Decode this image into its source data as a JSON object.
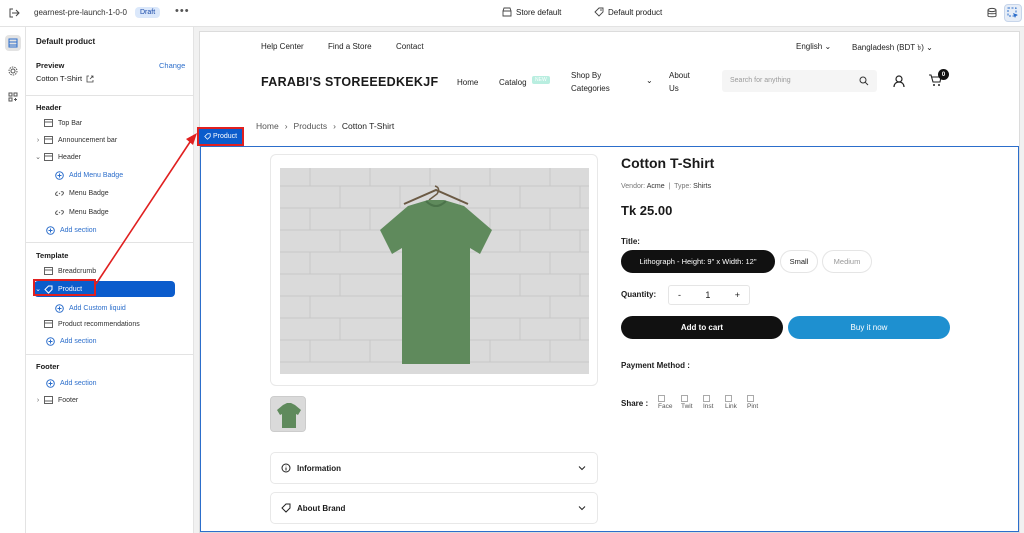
{
  "topbar": {
    "theme_name": "gearnest-pre-launch-1-0-0",
    "status_badge": "Draft",
    "more": "•••",
    "store_selector": "Store default",
    "template_selector": "Default product"
  },
  "sidebar": {
    "title": "Default product",
    "preview_label": "Preview",
    "change_link": "Change",
    "preview_value": "Cotton T-Shirt",
    "groups": {
      "header": {
        "label": "Header",
        "top_bar": "Top Bar",
        "announcement_bar": "Announcement bar",
        "header": "Header",
        "add_menu_badge": "Add Menu Badge",
        "menu_badge_1": "Menu Badge",
        "menu_badge_2": "Menu Badge",
        "add_section": "Add section"
      },
      "template": {
        "label": "Template",
        "breadcrumb": "Breadcrumb",
        "product": "Product",
        "add_custom_liquid": "Add Custom liquid",
        "product_recommendations": "Product recommendations",
        "add_section": "Add section"
      },
      "footer": {
        "label": "Footer",
        "add_section": "Add section",
        "footer": "Footer"
      }
    }
  },
  "store": {
    "util_links": [
      "Help Center",
      "Find a Store",
      "Contact"
    ],
    "language": "English",
    "currency": "Bangladesh (BDT ৳)",
    "logo": "FARABI'S STOREEEDKEKJF",
    "nav": {
      "home": "Home",
      "catalog": "Catalog",
      "new_tag": "NEW",
      "shop_line1": "Shop By",
      "shop_line2": "Categories",
      "about_line1": "About",
      "about_line2": "Us"
    },
    "search_placeholder": "Search for anything",
    "cart_count": "0",
    "breadcrumb": {
      "home": "Home",
      "products": "Products",
      "current": "Cotton T-Shirt"
    },
    "section_tag": "Product",
    "product": {
      "title": "Cotton T-Shirt",
      "vendor_label": "Vendor:",
      "vendor": "Acme",
      "separator": "|",
      "type_label": "Type:",
      "type": "Shirts",
      "price": "Tk 25.00",
      "title_option_label": "Title:",
      "options": [
        "Lithograph - Height: 9\" x Width: 12\"",
        "Small",
        "Medium"
      ],
      "quantity_label": "Quantity:",
      "qty_minus": "-",
      "quantity": "1",
      "qty_plus": "+",
      "add_to_cart": "Add to cart",
      "buy_now": "Buy it now",
      "payment_label": "Payment Method :",
      "share_label": "Share :",
      "share_icons": [
        "Face",
        "Twit",
        "Inst",
        "Link",
        "Pint"
      ],
      "accordions": [
        "Information",
        "About Brand"
      ]
    }
  },
  "colors": {
    "accent": "#0b5ccc",
    "buy_now": "#1e90d0",
    "annotation": "#e02020",
    "shirt": "#5f8a5c"
  }
}
